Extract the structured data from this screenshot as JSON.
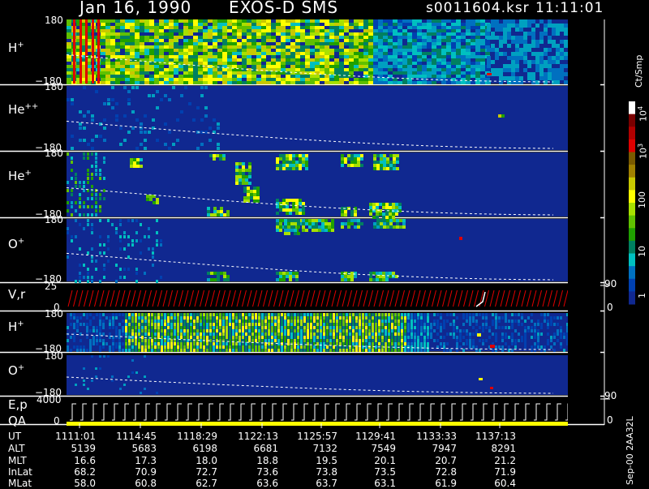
{
  "header": {
    "date": "Jan 16, 1990",
    "mission": "EXOS-D SMS",
    "file": "s0011604.ksr",
    "time": "11:11:01"
  },
  "panels": [
    {
      "label": "H",
      "sup": "+",
      "top_tick": "180",
      "bottom_tick": "−180"
    },
    {
      "label": "He",
      "sup": "++",
      "top_tick": "180",
      "bottom_tick": "−180"
    },
    {
      "label": "He",
      "sup": "+",
      "top_tick": "180",
      "bottom_tick": "−180"
    },
    {
      "label": "O",
      "sup": "+",
      "top_tick": "180",
      "bottom_tick": "−180"
    },
    {
      "label": "V,r",
      "sup": "",
      "top_tick": "25",
      "bottom_tick": "0"
    },
    {
      "label": "H",
      "sup": "+",
      "top_tick": "180",
      "bottom_tick": "−180"
    },
    {
      "label": "O",
      "sup": "+",
      "top_tick": "180",
      "bottom_tick": "−180"
    },
    {
      "label": "E,p",
      "sup": "",
      "top_tick": "4000",
      "bottom_tick": "0"
    }
  ],
  "qa_label": "QA",
  "right_ticks": [
    {
      "text": "90"
    },
    {
      "text": "0"
    },
    {
      "text": "90"
    },
    {
      "text": "0"
    }
  ],
  "colorbar": {
    "unit": "Ct/Smp",
    "labels": [
      {
        "text": "10",
        "sup": "4"
      },
      {
        "text": "10",
        "sup": "3"
      },
      {
        "text": "100",
        "sup": ""
      },
      {
        "text": "10",
        "sup": ""
      },
      {
        "text": "1",
        "sup": ""
      }
    ],
    "colors": [
      "#ffffff",
      "#7a0000",
      "#b00000",
      "#e00000",
      "#7a5a00",
      "#a08000",
      "#c8c800",
      "#ffff00",
      "#a8e000",
      "#60c000",
      "#20a000",
      "#008060",
      "#00c0c0",
      "#0070c0",
      "#0040b0",
      "#102890"
    ]
  },
  "footer_code": "Sep-00  2AA32L",
  "table": {
    "row_labels": [
      "UT",
      "ALT",
      "MLT",
      "InLat",
      "MLat"
    ],
    "columns": [
      [
        "1111:01",
        "5139",
        "16.6",
        "68.2",
        "58.0"
      ],
      [
        "1114:45",
        "5683",
        "17.3",
        "70.9",
        "60.8"
      ],
      [
        "1118:29",
        "6198",
        "18.0",
        "72.7",
        "62.7"
      ],
      [
        "1122:13",
        "6681",
        "18.8",
        "73.6",
        "63.6"
      ],
      [
        "1125:57",
        "7132",
        "19.5",
        "73.8",
        "63.7"
      ],
      [
        "1129:41",
        "7549",
        "20.1",
        "73.5",
        "63.1"
      ],
      [
        "1133:33",
        "7947",
        "20.7",
        "72.8",
        "61.9"
      ],
      [
        "1137:13",
        "8291",
        "21.2",
        "71.9",
        "60.4"
      ]
    ]
  },
  "chart_data": {
    "type": "heatmap",
    "x_ticks": [
      "1111:01",
      "1114:45",
      "1118:29",
      "1122:13",
      "1125:57",
      "1129:41",
      "1133:33",
      "1137:13"
    ],
    "panels": [
      "H+",
      "He++",
      "He+",
      "O+",
      "V,r",
      "H+",
      "O+",
      "E,p"
    ],
    "pitch_angle_range": [
      -180,
      180
    ],
    "colorbar_range": [
      1,
      10000
    ],
    "colorbar_scale": "log"
  }
}
